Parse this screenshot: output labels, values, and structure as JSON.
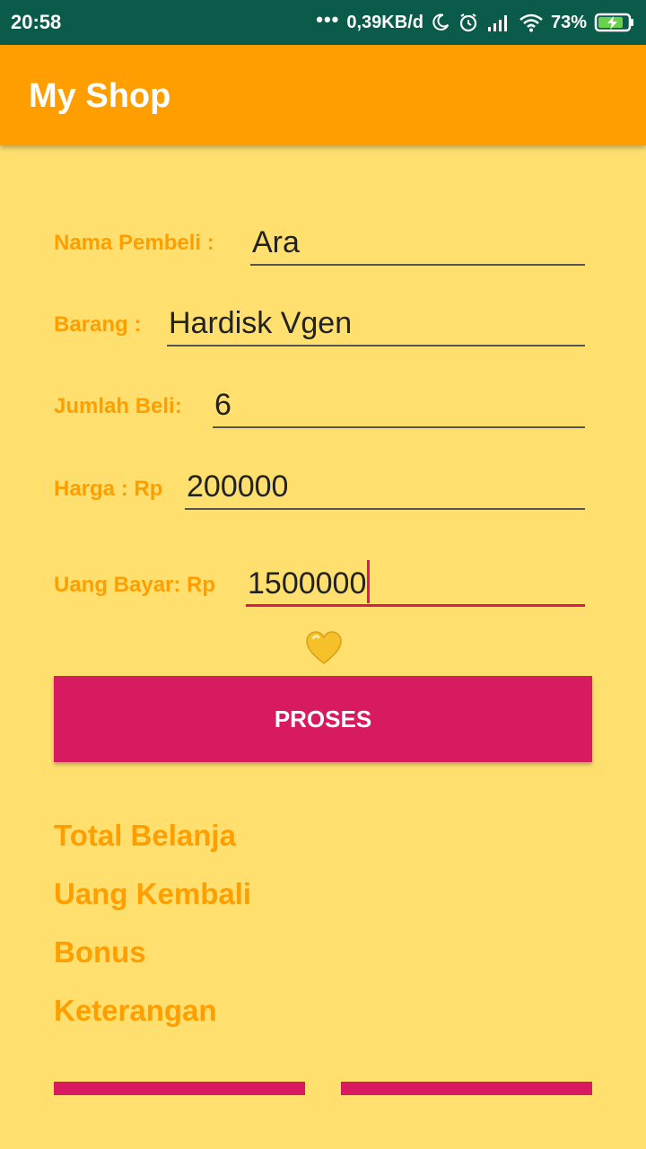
{
  "status_bar": {
    "time": "20:58",
    "dots": "•••",
    "network_speed": "0,39KB/d",
    "battery_percent": "73%",
    "icons": [
      "moon-icon",
      "alarm-icon",
      "signal-icon",
      "wifi-icon",
      "battery-charging-icon"
    ]
  },
  "app_bar": {
    "title": "My Shop"
  },
  "form": {
    "nama_pembeli": {
      "label": "Nama Pembeli :",
      "value": "Ara"
    },
    "barang": {
      "label": "Barang :",
      "value": "Hardisk Vgen"
    },
    "jumlah_beli": {
      "label": "Jumlah Beli:",
      "value": "6"
    },
    "harga": {
      "label": "Harga : Rp",
      "value": "200000"
    },
    "uang_bayar": {
      "label": "Uang Bayar: Rp",
      "value": "1500000"
    }
  },
  "heart_icon": "yellow-heart-icon",
  "proses_button": {
    "label": "PROSES"
  },
  "results": {
    "total_belanja": "Total Belanja",
    "uang_kembali": "Uang Kembali",
    "bonus": "Bonus",
    "keterangan": "Keterangan"
  },
  "colors": {
    "status_bar": "#0B5B4B",
    "app_bar": "#FF9E00",
    "background": "#FFE06F",
    "accent": "#D81B60",
    "label": "#FF9E00"
  }
}
